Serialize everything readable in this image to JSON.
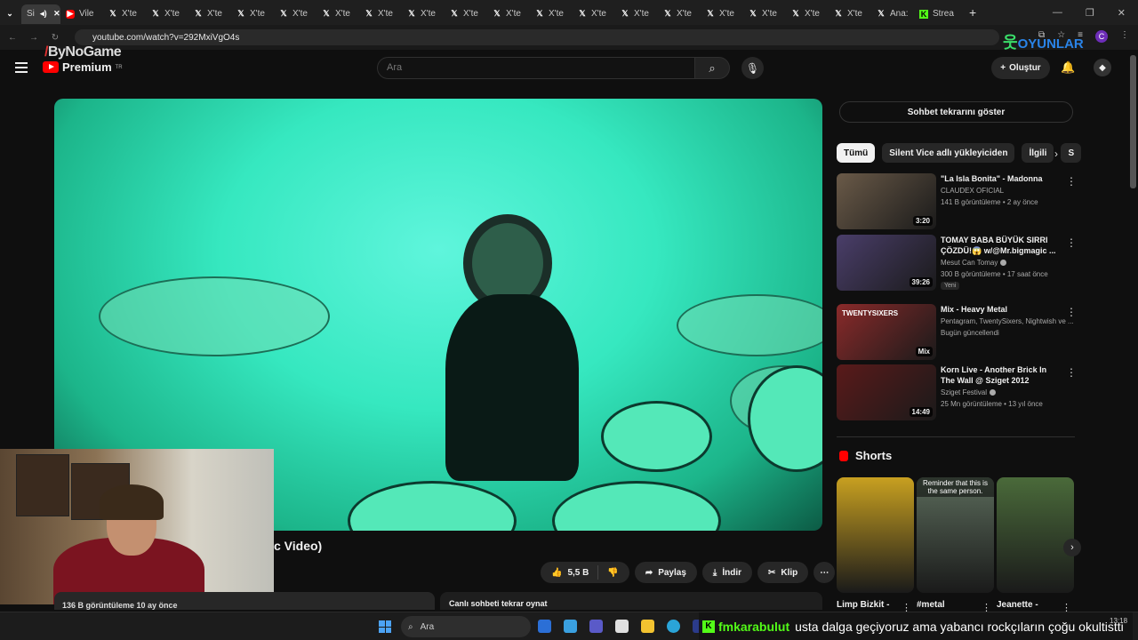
{
  "browser": {
    "first_tab_label": "Si",
    "tabs": [
      {
        "icon": "youtube-icon",
        "label": "Vile"
      },
      {
        "icon": "x-icon",
        "label": "X'te"
      },
      {
        "icon": "x-icon",
        "label": "X'te"
      },
      {
        "icon": "x-icon",
        "label": "X'te"
      },
      {
        "icon": "x-icon",
        "label": "X'te"
      },
      {
        "icon": "x-icon",
        "label": "X'te"
      },
      {
        "icon": "x-icon",
        "label": "X'te"
      },
      {
        "icon": "x-icon",
        "label": "X'te"
      },
      {
        "icon": "x-icon",
        "label": "X'te"
      },
      {
        "icon": "x-icon",
        "label": "X'te"
      },
      {
        "icon": "x-icon",
        "label": "X'te"
      },
      {
        "icon": "x-icon",
        "label": "X'te"
      },
      {
        "icon": "x-icon",
        "label": "X'te"
      },
      {
        "icon": "x-icon",
        "label": "X'te"
      },
      {
        "icon": "x-icon",
        "label": "X'te"
      },
      {
        "icon": "x-icon",
        "label": "X'te"
      },
      {
        "icon": "x-icon",
        "label": "X'te"
      },
      {
        "icon": "x-icon",
        "label": "X'te"
      },
      {
        "icon": "x-icon",
        "label": "X'te"
      },
      {
        "icon": "x-icon",
        "label": "Ana:"
      },
      {
        "icon": "kick-icon",
        "label": "Strea"
      }
    ],
    "url": "youtube.com/watch?v=292MxiVgO4s",
    "profile_initial": "C"
  },
  "overlay": {
    "bynogame": "ByNoGame",
    "oyunlar": "OYUNLAR"
  },
  "masthead": {
    "brand": "Premium",
    "brand_sup": "TR",
    "search_placeholder": "Ara",
    "create_label": "Oluştur"
  },
  "video": {
    "title_fragment": "c Video)",
    "views": "136 B görüntüleme  10 ay önce",
    "likes": "5,5 B",
    "share": "Paylaş",
    "download": "İndir",
    "clip": "Klip",
    "live_chat_replay": "Canlı sohbeti tekrar oynat"
  },
  "sidebar": {
    "chat_button": "Sohbet tekrarını göster",
    "chips": [
      "Tümü",
      "Silent Vice adlı yükleyiciden",
      "İlgili",
      "S"
    ],
    "recommendations": [
      {
        "title": "\"La Isla Bonita\" - Madonna",
        "channel": "CLAUDEX OFICIAL",
        "verified": false,
        "meta": "141 B görüntüleme • 2 ay önce",
        "duration": "3:20",
        "badge": "",
        "thumb_color": "#6a5a48"
      },
      {
        "title": "TOMAY BABA BÜYÜK SIRRI ÇÖZDÜ!😱 w/@Mr.bigmagic ...",
        "channel": "Mesut Can Tomay",
        "verified": true,
        "meta": "300 B görüntüleme • 17 saat önce",
        "duration": "39:26",
        "badge": "Yeni",
        "thumb_color": "#4a3e6a"
      },
      {
        "title": "Mix - Heavy Metal",
        "channel": "Pentagram, TwentySixers, Nightwish ve ...",
        "verified": false,
        "meta": "Bugün güncellendi",
        "duration": "Mix",
        "badge": "",
        "thumb_color": "#8a2a2a",
        "thumb_text": "TWENTYSIXERS"
      },
      {
        "title": "Korn Live - Another Brick In The Wall @ Sziget 2012",
        "channel": "Sziget Festival",
        "verified": true,
        "meta": "25 Mn görüntüleme • 13 yıl önce",
        "duration": "14:49",
        "badge": "",
        "thumb_color": "#5a1a1a"
      }
    ],
    "shorts_heading": "Shorts",
    "shorts": [
      {
        "title": "Limp Bizkit -",
        "color": "#c8a020"
      },
      {
        "title": "#metal",
        "color": "#5a6a5a",
        "caption": "Reminder that this is the same person."
      },
      {
        "title": "Jeanette -",
        "color": "#4a6a3a"
      }
    ]
  },
  "taskbar": {
    "search": "Ara",
    "ticker_user": "fmkarabulut",
    "ticker_text": "usta dalga geçiyoruz ama yabancı rockçıların çoğu okultistti",
    "time": "13:18"
  }
}
